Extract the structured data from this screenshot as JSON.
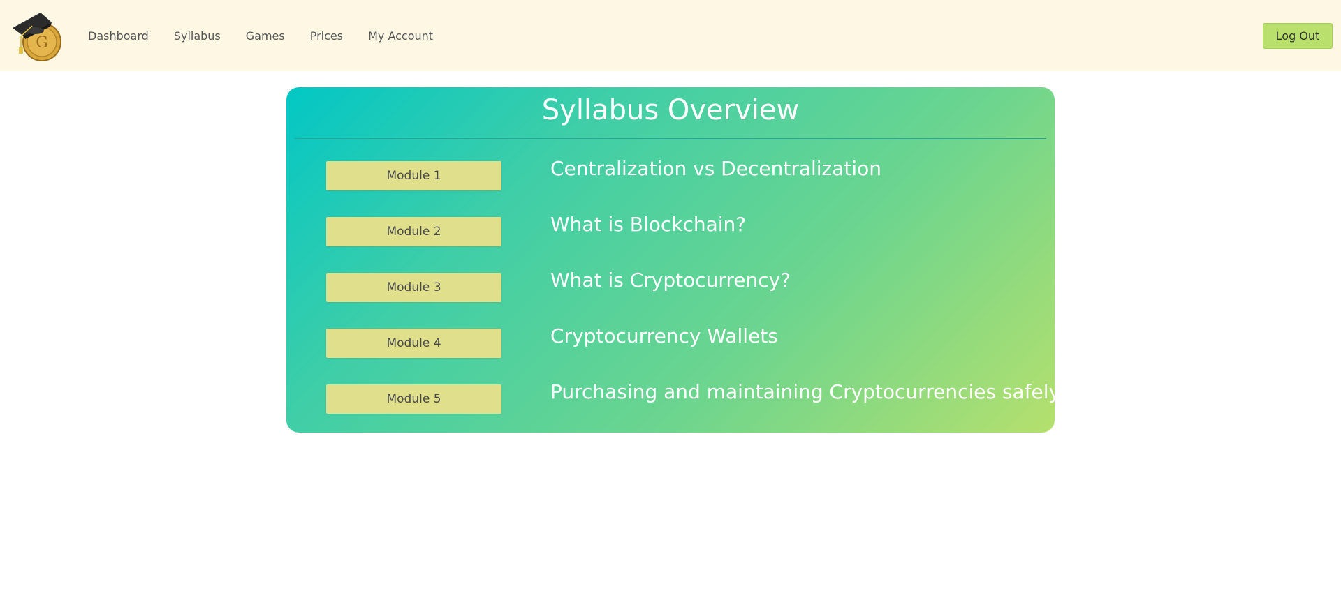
{
  "nav": {
    "logo_label": "",
    "links": [
      "Dashboard",
      "Syllabus",
      "Games",
      "Prices",
      "My Account"
    ],
    "logout_label": "Log Out"
  },
  "syllabus": {
    "title": "Syllabus Overview",
    "modules": [
      {
        "label": "Module 1",
        "title": "Centralization vs Decentralization"
      },
      {
        "label": "Module 2",
        "title": "What is Blockchain?"
      },
      {
        "label": "Module 3",
        "title": "What is Cryptocurrency?"
      },
      {
        "label": "Module 4",
        "title": "Cryptocurrency Wallets"
      },
      {
        "label": "Module 5",
        "title": "Purchasing and maintaining Cryptocurrencies safely"
      }
    ]
  },
  "colors": {
    "navbar_bg": "#fdf7e4",
    "logout_bg": "#b9e06d",
    "gradient_start": "#02c7c5",
    "gradient_end": "#b5e06d",
    "module_button_bg": "#dfdf8c"
  },
  "icons": {
    "logo": "graduation-cap-coin-logo"
  }
}
